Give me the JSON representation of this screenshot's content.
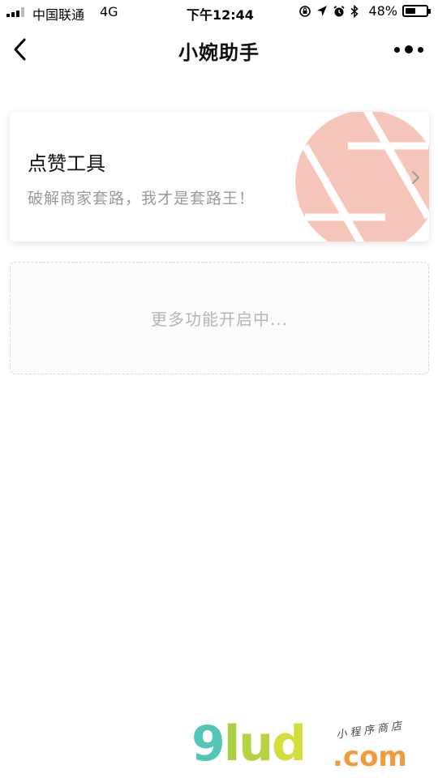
{
  "status_bar": {
    "carrier": "中国联通",
    "network": "4G",
    "time": "下午12:44",
    "battery": "48%",
    "battery_level": 0.48,
    "icons": [
      "signal-icon",
      "rotation-lock-icon",
      "location-arrow-icon",
      "alarm-icon",
      "bluetooth-icon",
      "battery-icon"
    ]
  },
  "header": {
    "title": "小婉助手",
    "back_icon": "chevron-left-icon",
    "more_icon": "more-dots-icon"
  },
  "feature_card": {
    "title": "点赞工具",
    "subtitle": "破解商家套路，我才是套路王！",
    "icon": "aperture-icon",
    "accent_color": "#f6c6bb"
  },
  "placeholder_card": {
    "text": "更多功能开启中..."
  },
  "watermark": {
    "brand": "9lud",
    "domain": ".com",
    "tagline": "小程序商店"
  }
}
